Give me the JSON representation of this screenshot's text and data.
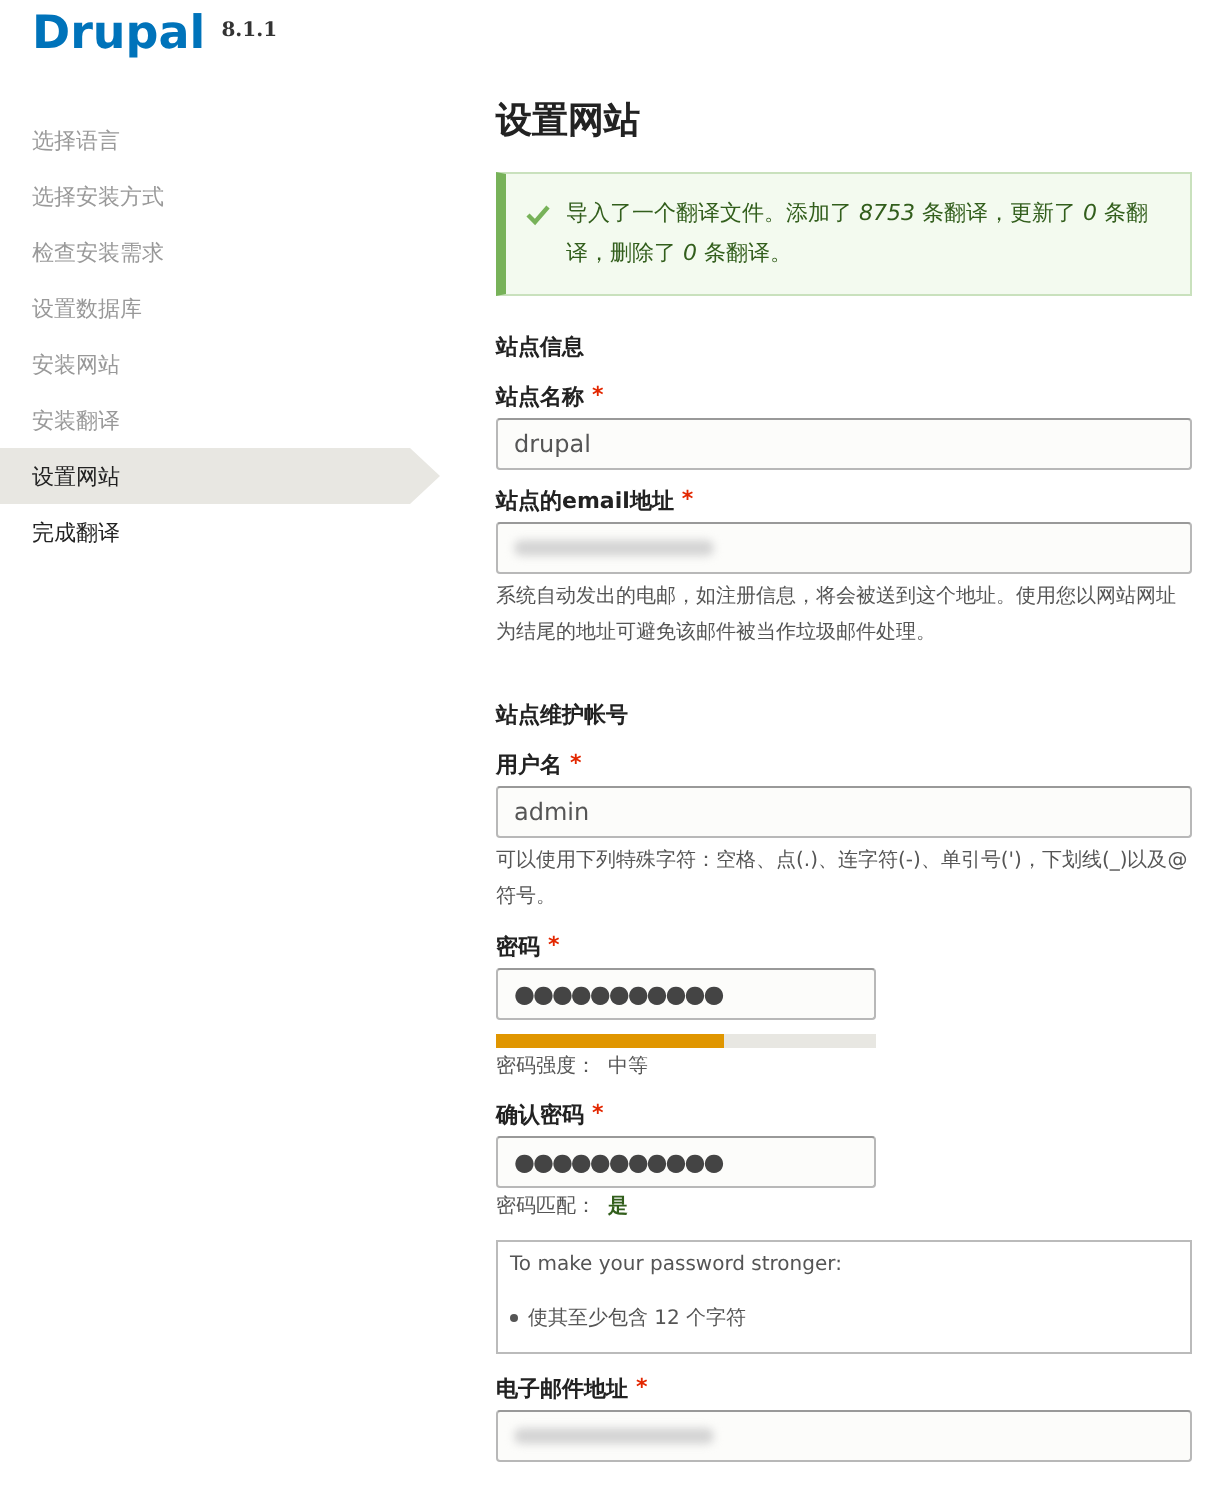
{
  "header": {
    "logo": "Drupal",
    "version": "8.1.1"
  },
  "steps": [
    {
      "label": "选择语言",
      "done": true,
      "selected": false
    },
    {
      "label": "选择安装方式",
      "done": true,
      "selected": false
    },
    {
      "label": "检查安装需求",
      "done": true,
      "selected": false
    },
    {
      "label": "设置数据库",
      "done": true,
      "selected": false
    },
    {
      "label": "安装网站",
      "done": true,
      "selected": false
    },
    {
      "label": "安装翻译",
      "done": true,
      "selected": false
    },
    {
      "label": "设置网站",
      "done": false,
      "selected": true
    },
    {
      "label": "完成翻译",
      "done": false,
      "selected": false
    }
  ],
  "page_title": "设置网站",
  "message": {
    "kind": "status",
    "text": "导入了一个翻译文件。添加了 *8753* 条翻译，更新了 *0* 条翻译，删除了 *0* 条翻译。"
  },
  "sections": [
    {
      "heading": "站点信息",
      "fields": [
        {
          "kind": "text",
          "label": "站点名称",
          "required_mark": "*",
          "value": "drupal"
        },
        {
          "kind": "blurred",
          "label": "站点的email地址",
          "required_mark": "*",
          "description": "系统自动发出的电邮，如注册信息，将会被送到这个地址。使用您以网站网址为结尾的地址可避免该邮件被当作垃圾邮件处理。"
        }
      ]
    },
    {
      "heading": "站点维护帐号",
      "fields": [
        {
          "kind": "text",
          "label": "用户名",
          "required_mark": "*",
          "value": "admin",
          "description": "可以使用下列特殊字符：空格、点(.)、连字符(-)、单引号(')，下划线(_)以及@符号。"
        },
        {
          "kind": "password",
          "label": "密码",
          "required_mark": "*",
          "value": "●●●●●●●●●●●",
          "strength": {
            "level": 0.6,
            "label": "密码强度：",
            "value": "中等"
          }
        },
        {
          "kind": "password",
          "label": "确认密码",
          "required_mark": "*",
          "value": "●●●●●●●●●●●",
          "match": {
            "label": "密码匹配：",
            "value": "是"
          }
        },
        {
          "kind": "suggestions",
          "title": "To make your password stronger:",
          "items": [
            "使其至少包含 12 个字符"
          ]
        },
        {
          "kind": "blurred",
          "label": "电子邮件地址",
          "required_mark": "*"
        }
      ]
    }
  ]
}
